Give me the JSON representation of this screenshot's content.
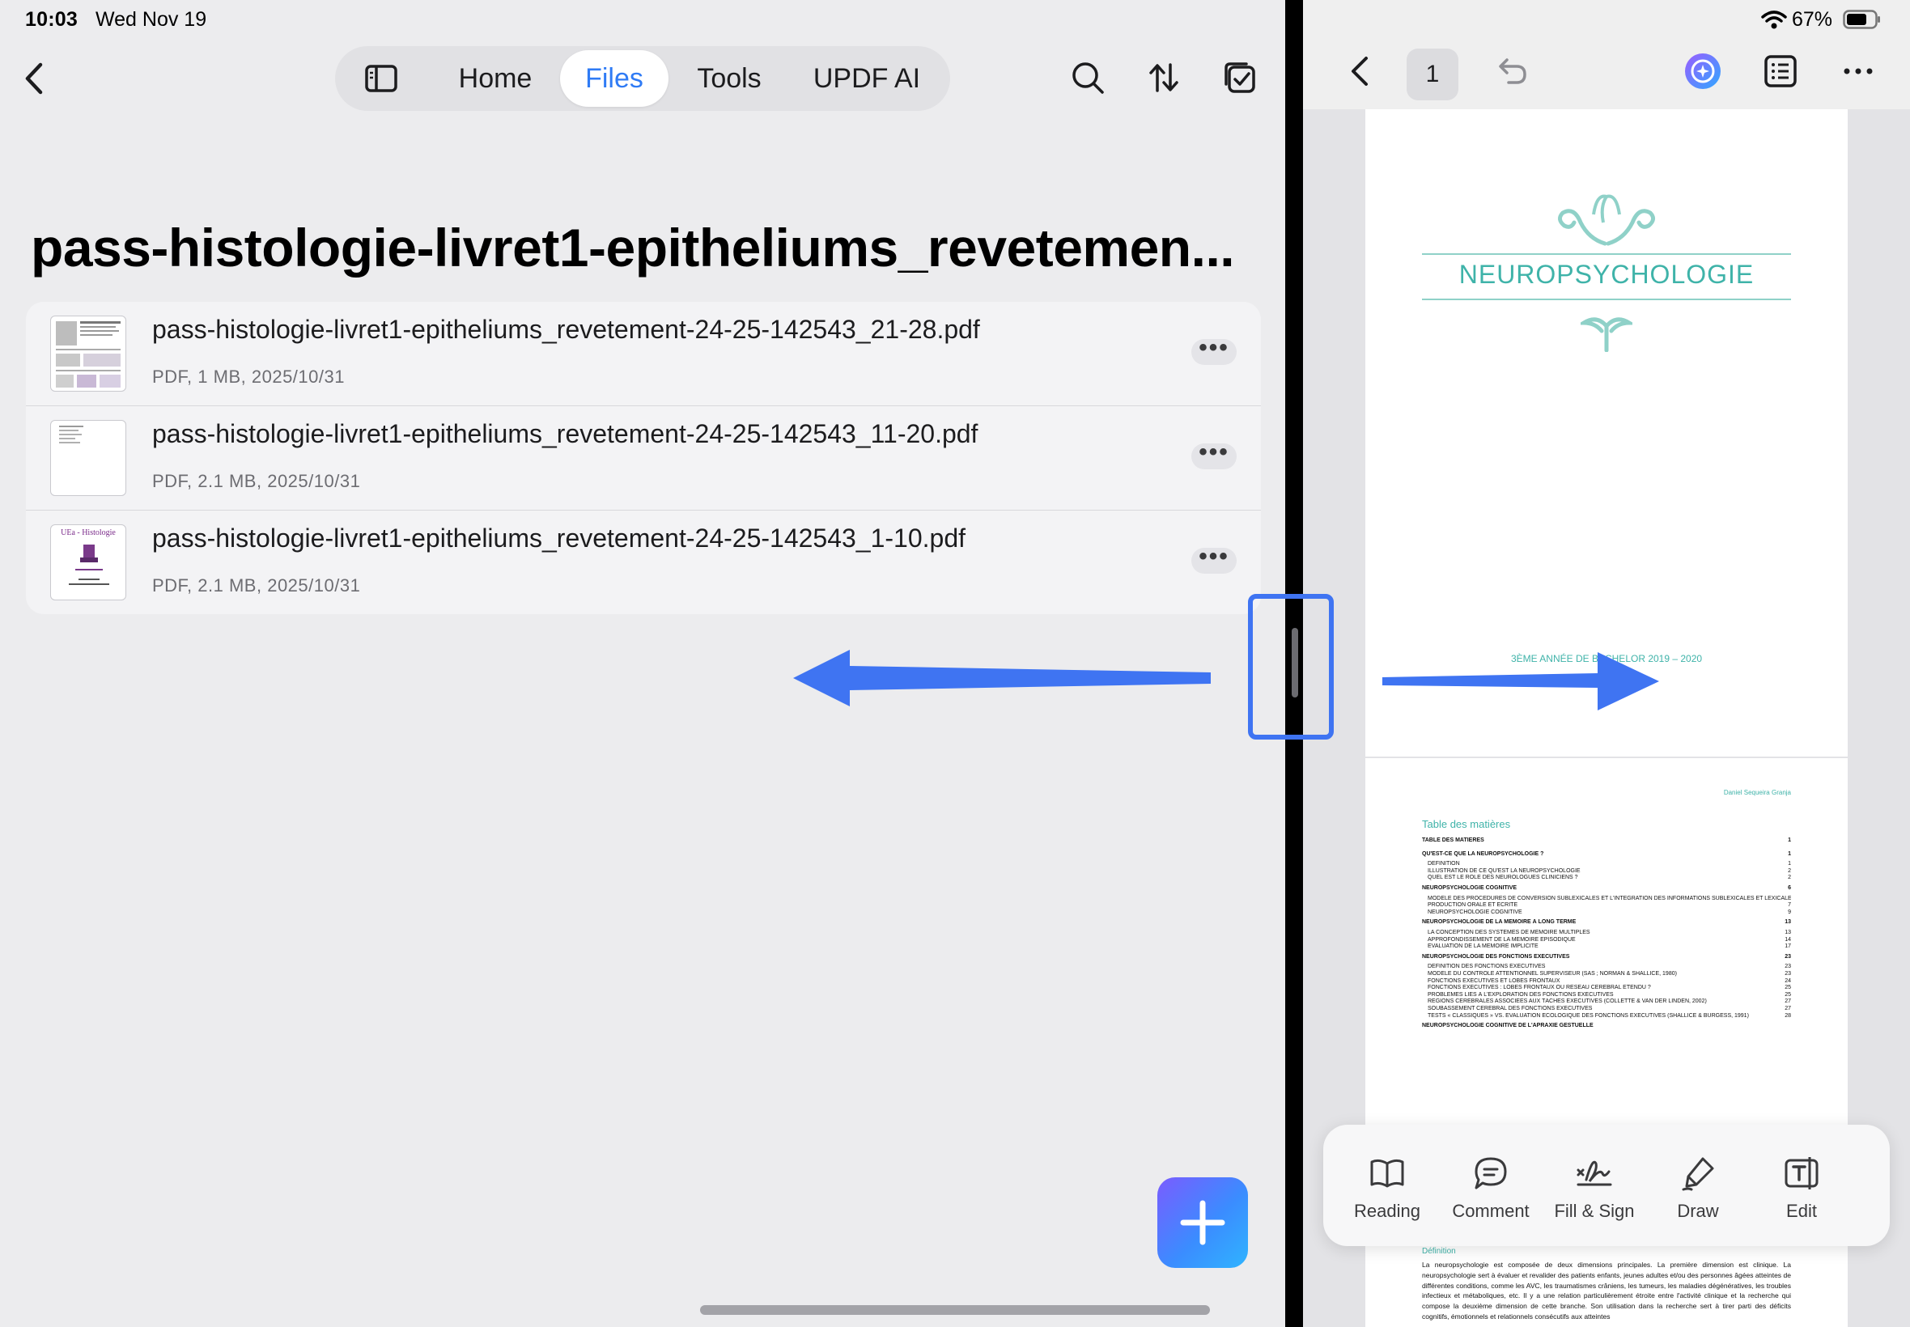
{
  "status_bar": {
    "time": "10:03",
    "date": "Wed Nov 19",
    "battery": "67%"
  },
  "left_toolbar": {
    "tabs": [
      {
        "label": "Home"
      },
      {
        "label": "Files",
        "active": true
      },
      {
        "label": "Tools"
      },
      {
        "label": "UPDF AI"
      }
    ]
  },
  "folder": {
    "title": "pass-histologie-livret1-epitheliums_revetemen...",
    "files": [
      {
        "name": "pass-histologie-livret1-epitheliums_revetement-24-25-142543_21-28.pdf",
        "meta": "PDF, 1 MB, 2025/10/31"
      },
      {
        "name": "pass-histologie-livret1-epitheliums_revetement-24-25-142543_11-20.pdf",
        "meta": "PDF, 2.1 MB, 2025/10/31"
      },
      {
        "name": "pass-histologie-livret1-epitheliums_revetement-24-25-142543_1-10.pdf",
        "meta": "PDF, 2.1 MB, 2025/10/31"
      }
    ],
    "more_glyph": "•••",
    "thumb3_title": "UEa - Histologie"
  },
  "viewer": {
    "page_number": "1",
    "doc_title": "NEUROPSYCHOLOGIE",
    "doc_subtitle": "3ÈME ANNÉE DE BACHELOR 2019 – 2020",
    "author": "Daniel Sequeira Granja",
    "toc_heading": "Table des matières",
    "toc": [
      {
        "text": "TABLE DES MATIÈRES",
        "page": "1",
        "bold": true
      },
      {
        "text": "QU'EST-CE QUE LA NEUROPSYCHOLOGIE ?",
        "page": "1",
        "bold": true
      },
      {
        "text": "DÉFINITION",
        "page": "1"
      },
      {
        "text": "ILLUSTRATION DE CE QU'EST LA NEUROPSYCHOLOGIE",
        "page": "2"
      },
      {
        "text": "QUEL EST LE RÔLE DES NEUROLOGUES CLINICIENS ?",
        "page": "2"
      },
      {
        "text": "NEUROPSYCHOLOGIE COGNITIVE",
        "page": "6",
        "bold": true
      },
      {
        "text": "MODÈLE DES PROCÉDURES DE CONVERSION SUBLEXICALES ET L'INTÉGRATION DES INFORMATIONS SUBLEXICALES ET LEXICALES EN",
        "page": ""
      },
      {
        "text": "PRODUCTION ORALE ET ÉCRITE",
        "page": "7"
      },
      {
        "text": "NEUROPSYCHOLOGIE COGNITIVE",
        "page": "9"
      },
      {
        "text": "NEUROPSYCHOLOGIE DE LA MÉMOIRE À LONG TERME",
        "page": "13",
        "bold": true
      },
      {
        "text": "LA CONCEPTION DES SYSTÈMES DE MÉMOIRE MULTIPLES",
        "page": "13"
      },
      {
        "text": "APPROFONDISSEMENT DE LA MÉMOIRE ÉPISODIQUE",
        "page": "14"
      },
      {
        "text": "ÉVALUATION DE LA MÉMOIRE IMPLICITE",
        "page": "17"
      },
      {
        "text": "NEUROPSYCHOLOGIE DES FONCTIONS EXÉCUTIVES",
        "page": "23",
        "bold": true
      },
      {
        "text": "DÉFINITION DES FONCTIONS EXÉCUTIVES",
        "page": "23"
      },
      {
        "text": "MODÈLE DU CONTRÔLE ATTENTIONNEL SUPERVISEUR (SAS ; NORMAN & SHALLICE, 1980)",
        "page": "23"
      },
      {
        "text": "FONCTIONS EXÉCUTIVES ET LOBES FRONTAUX",
        "page": "24"
      },
      {
        "text": "FONCTIONS EXÉCUTIVES : LOBES FRONTAUX OU RÉSEAU CÉRÉBRAL ÉTENDU ?",
        "page": "25"
      },
      {
        "text": "PROBLÈMES LIÉS À L'EXPLORATION DES FONCTIONS EXÉCUTIVES",
        "page": "25"
      },
      {
        "text": "RÉGIONS CÉRÉBRALES ASSOCIÉES AUX TÂCHES EXÉCUTIVES (COLLETTE & VAN DER LINDEN, 2002)",
        "page": "27"
      },
      {
        "text": "SOUBASSEMENT CÉRÉBRAL DES FONCTIONS EXÉCUTIVES",
        "page": "27"
      },
      {
        "text": "TESTS « CLASSIQUES » VS. ÉVALUATION ÉCOLOGIQUE DES FONCTIONS EXÉCUTIVES (SHALLICE & BURGESS, 1991)",
        "page": "28"
      },
      {
        "text": "NEUROPSYCHOLOGIE COGNITIVE DE L'APRAXIE GESTUELLE",
        "page": "",
        "bold": true
      }
    ],
    "section_heading": "Définition",
    "body_text": "La neuropsychologie est composée de deux dimensions principales. La première dimension est clinique. La neuropsychologie sert à évaluer et revalider des patients enfants, jeunes adultes et/ou des personnes âgées atteintes de différentes conditions, comme les AVC, les traumatismes crâniens, les tumeurs, les maladies dégénératives, les troubles infectieux et métaboliques, etc. Il y a une relation particulièrement étroite entre l'activité clinique et la recherche qui compose la deuxième dimension de cette branche. Son utilisation dans la recherche sert à tirer parti des déficits cognitifs, émotionnels et relationnels consécutifs aux atteintes",
    "tools": [
      {
        "label": "Reading",
        "icon": "book-icon"
      },
      {
        "label": "Comment",
        "icon": "comment-icon"
      },
      {
        "label": "Fill & Sign",
        "icon": "signature-icon"
      },
      {
        "label": "Draw",
        "icon": "pen-icon"
      },
      {
        "label": "Edit",
        "icon": "text-edit-icon"
      }
    ]
  },
  "colors": {
    "accent": "#2f7bf5",
    "doc_teal": "#3fb3a9",
    "annotation_blue": "#3f74f2"
  }
}
